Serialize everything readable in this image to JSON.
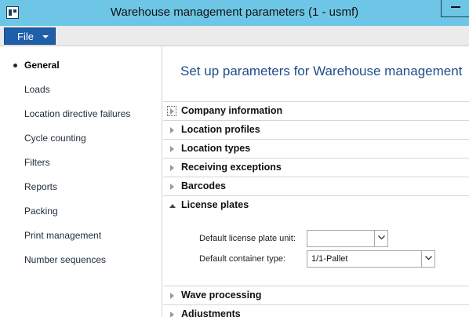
{
  "window": {
    "title": "Warehouse management parameters (1 - usmf)"
  },
  "menu": {
    "file_label": "File"
  },
  "nav": {
    "items": [
      {
        "label": "General",
        "selected": true
      },
      {
        "label": "Loads"
      },
      {
        "label": "Location directive failures"
      },
      {
        "label": "Cycle counting"
      },
      {
        "label": "Filters"
      },
      {
        "label": "Reports"
      },
      {
        "label": "Packing"
      },
      {
        "label": "Print management"
      },
      {
        "label": "Number sequences"
      }
    ]
  },
  "main": {
    "title": "Set up parameters for Warehouse management",
    "fasttabs": [
      {
        "label": "Company information",
        "expanded": false,
        "focused": true
      },
      {
        "label": "Location profiles",
        "expanded": false
      },
      {
        "label": "Location types",
        "expanded": false
      },
      {
        "label": "Receiving exceptions",
        "expanded": false
      },
      {
        "label": "Barcodes",
        "expanded": false
      },
      {
        "label": "License plates",
        "expanded": true
      },
      {
        "label": "Wave processing",
        "expanded": false
      },
      {
        "label": "Adjustments",
        "expanded": false
      }
    ],
    "license_plates": {
      "default_unit_label": "Default license plate unit:",
      "default_unit_value": "",
      "default_container_label": "Default container type:",
      "default_container_value": "1/1-Pallet"
    }
  },
  "colors": {
    "titlebar": "#6ec6e6",
    "file_button": "#1f5ea8",
    "page_title": "#1f4e8c"
  }
}
